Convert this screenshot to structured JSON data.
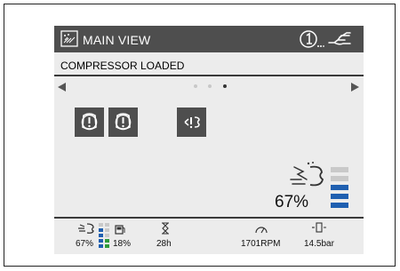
{
  "header": {
    "title": "MAIN VIEW",
    "home_icon": "home-grid-icon",
    "info_icon": "info-circle-icon",
    "hand_icon": "hand-icon"
  },
  "status": {
    "text": "COMPRESSOR LOADED"
  },
  "pager": {
    "pages": 3,
    "active_page": 3
  },
  "alarms": [
    {
      "icon": "warning-circle-icon"
    },
    {
      "icon": "warning-circle-icon"
    },
    {
      "icon": "warning-compressor-icon"
    }
  ],
  "load": {
    "value_text": "67%",
    "level": 0.67,
    "icon": "compressor-load-icon"
  },
  "footer": {
    "load": "67%",
    "fuel": "18%",
    "hours": "28h",
    "rpm": "1701RPM",
    "pressure": "14.5bar"
  },
  "colors": {
    "header": "#4e4e4e",
    "bar_active": "#1f5fb0",
    "bar_inactive": "#c9c9c9",
    "gauge_green": "#2e9b3a"
  }
}
